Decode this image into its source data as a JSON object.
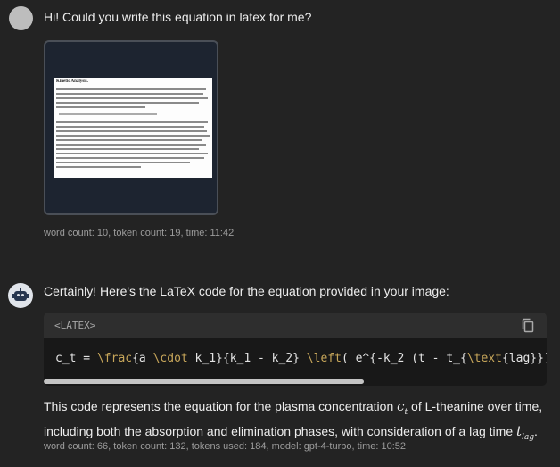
{
  "user_message": {
    "text": "Hi! Could you write this equation in latex for me?",
    "attachment": {
      "heading": "Kinetic Analysis."
    },
    "meta": "word count: 10, token count: 19, time: 11:42"
  },
  "assistant_message": {
    "intro": "Certainly! Here's the LaTeX code for the equation provided in your image:",
    "code": {
      "language_label": "<LATEX>",
      "copy_icon": "copy-icon",
      "line": {
        "p1": "c_t = ",
        "frac": "\\frac",
        "p2": "{a ",
        "cdot": "\\cdot",
        "p3": " k_1}{k_1 - k_2} ",
        "left": "\\left",
        "p4": "( e^{-k_2 (t - t_{",
        "textcmd": "\\text",
        "p5": "{lag}})}"
      }
    },
    "explanation": {
      "part1": "This code represents the equation for the plasma concentration ",
      "math1_base": "c",
      "math1_sub": "t",
      "part2": " of L-theanine over time, including both the absorption and elimination phases, with consideration of a lag time ",
      "math2_base": "t",
      "math2_sub": "lag",
      "part3": "."
    },
    "meta": "word count: 66, token count: 132, tokens used: 184, model: gpt-4-turbo, time: 10:52"
  },
  "colors": {
    "background": "#232323",
    "code_background": "#181818",
    "code_header": "#2e2e2e",
    "meta_text": "#9c9c9c"
  }
}
